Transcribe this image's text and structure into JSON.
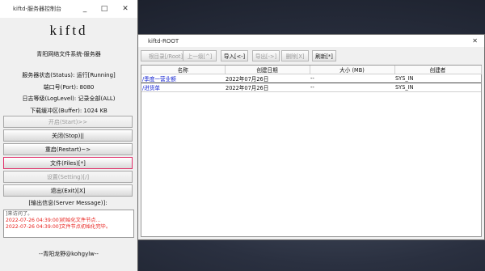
{
  "control_window": {
    "title": "kiftd-服务器控制台",
    "title_controls": [
      "_",
      "□",
      "✕"
    ],
    "logo": "kiftd",
    "subtitle": "青阳网络文件系统-服务器",
    "status_lines": [
      "服务器状态(Status): 运行[Running]",
      "端口号(Port): 8080",
      "日志等级(LogLevel): 记录全部(ALL)",
      "下载缓冲区(Buffer): 1024 KB"
    ],
    "buttons": {
      "start": "开启(Start)>>",
      "stop": "关闭(Stop)||",
      "restart": "重启(Restart)~>",
      "files": "文件(Files)[*]",
      "setting": "设置(Setting)[/]",
      "exit": "退出(Exit)[X]"
    },
    "output_label": "[输出信息(Server Message)]:",
    "messages": [
      "]来访问了。",
      "2022-07-26 04:39:00]初始化文件节点...",
      "2022-07-26 04:39:00]文件节点初始化完毕。"
    ],
    "footer": "--青阳龙野@kohgylw--"
  },
  "file_window": {
    "title": "kiftd-ROOT",
    "close": "✕",
    "toolbar": {
      "root": "根目录[/Root]",
      "up": "上一级[^]",
      "import": "导入[<-]",
      "export": "导出[->]",
      "delete": "删除[X]",
      "refresh": "刷新[*]"
    },
    "columns": [
      "名称",
      "创建日期",
      "大小 (MB)",
      "创建者"
    ],
    "rows": [
      {
        "name": "/季度一营业额",
        "date": "2022年07月26日",
        "size": "--",
        "creator": "SYS_IN"
      },
      {
        "name": "/进货单",
        "date": "2022年07月26日",
        "size": "--",
        "creator": "SYS_IN"
      }
    ]
  }
}
